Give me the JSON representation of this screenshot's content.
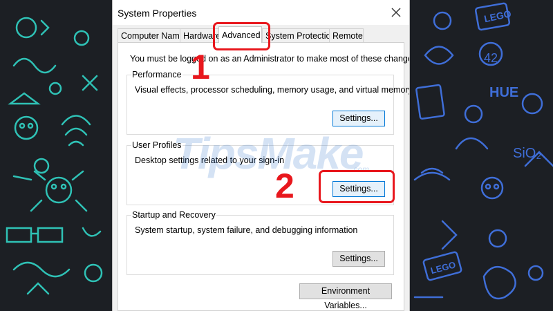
{
  "window": {
    "title": "System Properties",
    "close_icon": "close-icon"
  },
  "tabs": [
    {
      "label": "Computer Name",
      "active": false
    },
    {
      "label": "Hardware",
      "active": false
    },
    {
      "label": "Advanced",
      "active": true
    },
    {
      "label": "System Protection",
      "active": false
    },
    {
      "label": "Remote",
      "active": false
    }
  ],
  "advanced": {
    "admin_note": "You must be logged on as an Administrator to make most of these changes.",
    "performance": {
      "title": "Performance",
      "description": "Visual effects, processor scheduling, memory usage, and virtual memory",
      "button": "Settings..."
    },
    "user_profiles": {
      "title": "User Profiles",
      "description": "Desktop settings related to your sign-in",
      "button": "Settings..."
    },
    "startup_recovery": {
      "title": "Startup and Recovery",
      "description": "System startup, system failure, and debugging information",
      "button": "Settings..."
    },
    "env_button": "Environment Variables..."
  },
  "annotations": {
    "step1": "1",
    "step2": "2",
    "color": "#e8171d"
  },
  "watermark": {
    "text": "TipsMake",
    "suffix": ".com"
  },
  "wallpaper": {
    "left_color": "#2fc2b6",
    "right_color": "#3f6ed8",
    "labels": [
      "LEGO",
      "HUE",
      "42",
      "SiO2",
      "LEGO"
    ]
  }
}
